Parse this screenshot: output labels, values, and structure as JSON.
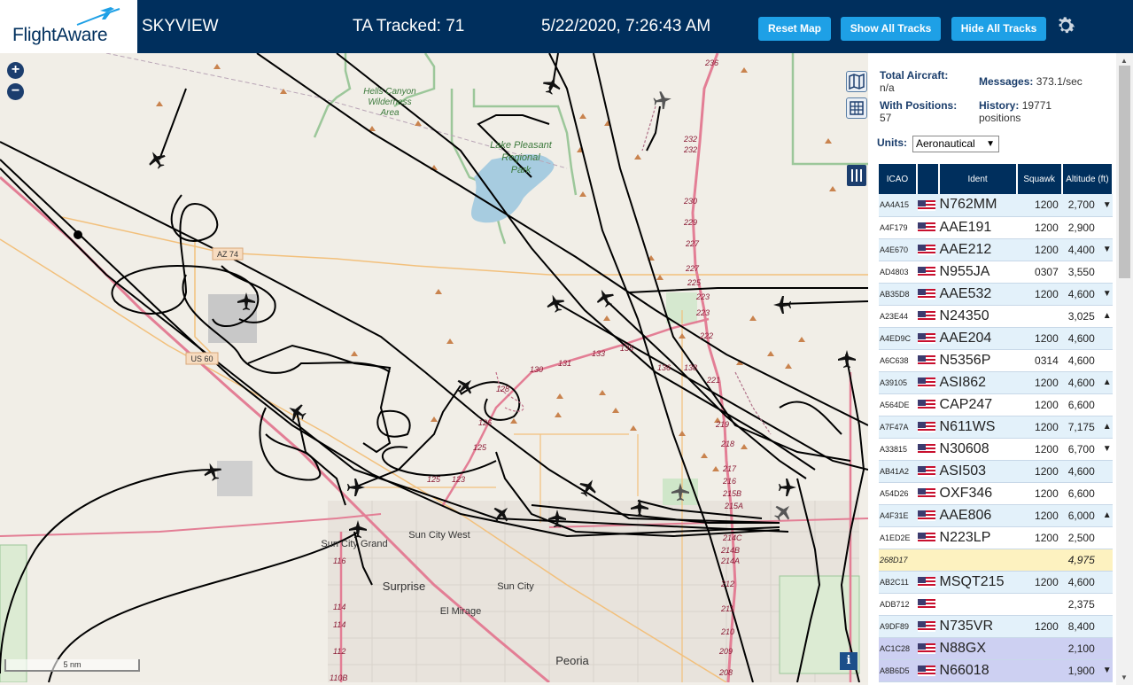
{
  "header": {
    "logo_text": "FlightAware",
    "app_name": "SKYVIEW",
    "tracked": "TA Tracked: 71",
    "datetime": "5/22/2020, 7:26:43 AM",
    "reset_label": "Reset Map",
    "show_label": "Show All Tracks",
    "hide_label": "Hide All Tracks"
  },
  "map": {
    "zoom_in": "+",
    "zoom_out": "−",
    "scale": "5 nm",
    "info": "i",
    "labels": {
      "hells1": "Hells Canyon",
      "hells2": "Wilderness",
      "hells3": "Area",
      "lake1": "Lake Pleasant",
      "lake2": "Regional",
      "lake3": "Park",
      "az74": "AZ 74",
      "us60": "US 60",
      "suncitygrand": "Sun City Grand",
      "suncitywest": "Sun City West",
      "surprise": "Surprise",
      "suncity": "Sun City",
      "elmirage": "El Mirage",
      "peoria": "Peoria"
    },
    "mileposts": [
      "236",
      "232",
      "232",
      "230",
      "229",
      "227",
      "227",
      "225",
      "223",
      "223",
      "222",
      "221",
      "219",
      "218",
      "217",
      "216",
      "215B",
      "215A",
      "214C",
      "214B",
      "214A",
      "212",
      "211",
      "210",
      "209",
      "208",
      "125",
      "123",
      "125",
      "126",
      "128",
      "130",
      "131",
      "133",
      "135",
      "136",
      "138",
      "116",
      "114",
      "114",
      "112",
      "110B"
    ]
  },
  "stats": {
    "total_label": "Total Aircraft:",
    "total_value": "n/a",
    "messages_label": "Messages:",
    "messages_value": "373.1/sec",
    "positions_label": "With Positions:",
    "positions_value": "57",
    "history_label": "History:",
    "history_value": "19771",
    "history_unit": "positions",
    "units_label": "Units:",
    "units_value": "Aeronautical"
  },
  "table": {
    "headers": [
      "ICAO",
      "",
      "Ident",
      "Squawk",
      "Altitude (ft)"
    ],
    "rows": [
      {
        "icao": "AA4A15",
        "ident": "N762MM",
        "squawk": "1200",
        "alt": "2,700",
        "arrow": "▼",
        "style": "odd"
      },
      {
        "icao": "A4F179",
        "ident": "AAE191",
        "squawk": "1200",
        "alt": "2,900",
        "arrow": "",
        "style": "even"
      },
      {
        "icao": "A4E670",
        "ident": "AAE212",
        "squawk": "1200",
        "alt": "4,400",
        "arrow": "▼",
        "style": "odd"
      },
      {
        "icao": "AD4803",
        "ident": "N955JA",
        "squawk": "0307",
        "alt": "3,550",
        "arrow": "",
        "style": "even"
      },
      {
        "icao": "AB35D8",
        "ident": "AAE532",
        "squawk": "1200",
        "alt": "4,600",
        "arrow": "▼",
        "style": "odd"
      },
      {
        "icao": "A23E44",
        "ident": "N24350",
        "squawk": "",
        "alt": "3,025",
        "arrow": "▲",
        "style": "even"
      },
      {
        "icao": "A4ED9C",
        "ident": "AAE204",
        "squawk": "1200",
        "alt": "4,600",
        "arrow": "",
        "style": "odd"
      },
      {
        "icao": "A6C638",
        "ident": "N5356P",
        "squawk": "0314",
        "alt": "4,600",
        "arrow": "",
        "style": "even"
      },
      {
        "icao": "A39105",
        "ident": "ASI862",
        "squawk": "1200",
        "alt": "4,600",
        "arrow": "▲",
        "style": "odd"
      },
      {
        "icao": "A564DE",
        "ident": "CAP247",
        "squawk": "1200",
        "alt": "6,600",
        "arrow": "",
        "style": "even"
      },
      {
        "icao": "A7F47A",
        "ident": "N611WS",
        "squawk": "1200",
        "alt": "7,175",
        "arrow": "▲",
        "style": "odd"
      },
      {
        "icao": "A33815",
        "ident": "N30608",
        "squawk": "1200",
        "alt": "6,700",
        "arrow": "▼",
        "style": "even"
      },
      {
        "icao": "AB41A2",
        "ident": "ASI503",
        "squawk": "1200",
        "alt": "4,600",
        "arrow": "",
        "style": "odd"
      },
      {
        "icao": "A54D26",
        "ident": "OXF346",
        "squawk": "1200",
        "alt": "6,600",
        "arrow": "",
        "style": "even"
      },
      {
        "icao": "A4F31E",
        "ident": "AAE806",
        "squawk": "1200",
        "alt": "6,000",
        "arrow": "▲",
        "style": "odd"
      },
      {
        "icao": "A1ED2E",
        "ident": "N223LP",
        "squawk": "1200",
        "alt": "2,500",
        "arrow": "",
        "style": "even"
      },
      {
        "icao": "268D17",
        "ident": "",
        "squawk": "",
        "alt": "4,975",
        "arrow": "",
        "style": "yellow",
        "noflag": true
      },
      {
        "icao": "AB2C11",
        "ident": "MSQT215",
        "squawk": "1200",
        "alt": "4,600",
        "arrow": "",
        "style": "odd"
      },
      {
        "icao": "ADB712",
        "ident": "",
        "squawk": "",
        "alt": "2,375",
        "arrow": "",
        "style": "even"
      },
      {
        "icao": "A9DF89",
        "ident": "N735VR",
        "squawk": "1200",
        "alt": "8,400",
        "arrow": "",
        "style": "odd"
      },
      {
        "icao": "AC1C28",
        "ident": "N88GX",
        "squawk": "",
        "alt": "2,100",
        "arrow": "",
        "style": "purple"
      },
      {
        "icao": "A8B6D5",
        "ident": "N66018",
        "squawk": "",
        "alt": "1,900",
        "arrow": "▼",
        "style": "purple"
      }
    ]
  },
  "colors": {
    "header_bg": "#002f5d",
    "button": "#1ea0e6",
    "track": "#000000",
    "highway": "#e37e95",
    "park": "#7bb87e"
  }
}
